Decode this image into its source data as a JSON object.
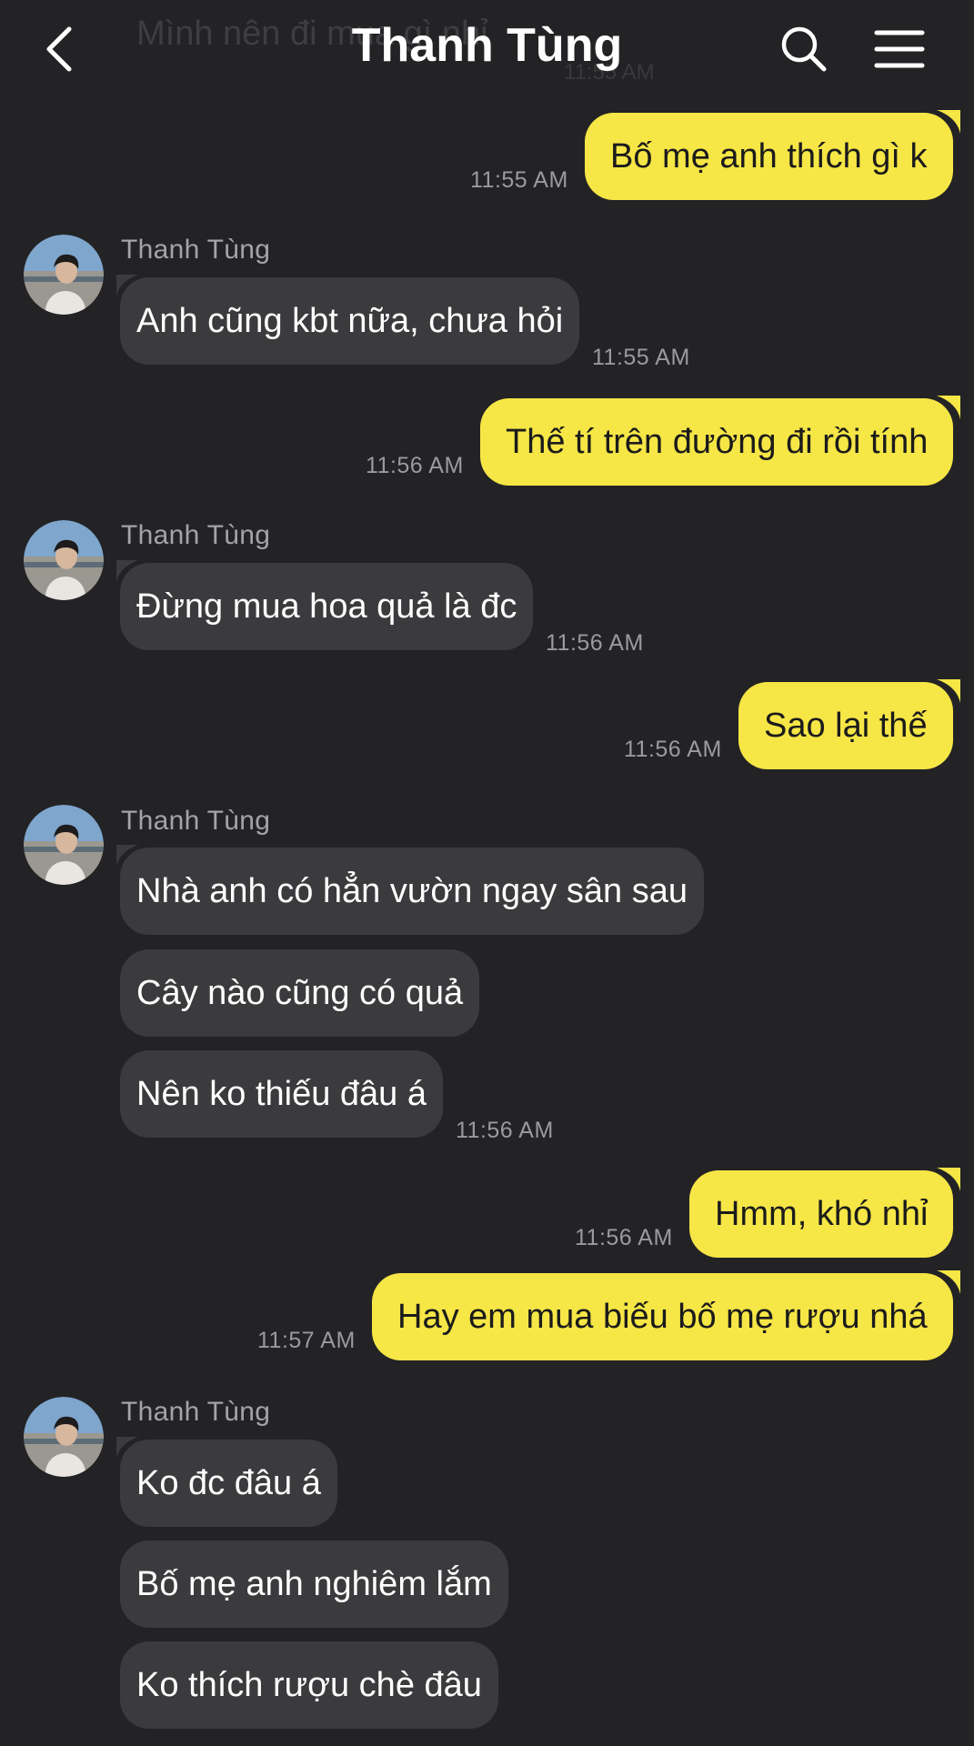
{
  "header": {
    "title": "Thanh Tùng",
    "ghost_preview": "Mình nên đi mua gì nhỉ",
    "ghost_time": "11:55 AM"
  },
  "icons": {
    "back": "chevron-left-icon",
    "search": "search-icon",
    "menu": "hamburger-menu-icon"
  },
  "colors": {
    "background": "#232325",
    "outgoing_bubble": "#f6e646",
    "incoming_bubble": "#3b3b3e",
    "timestamp": "#9a9a9f"
  },
  "messages": [
    {
      "dir": "out",
      "text": "Bố mẹ anh thích gì k",
      "time": "11:55 AM"
    },
    {
      "dir": "in",
      "sender": "Thanh Tùng",
      "text": "Anh cũng kbt nữa, chưa hỏi",
      "time": "11:55 AM"
    },
    {
      "dir": "out",
      "text": "Thế tí trên đường đi rồi tính",
      "time": "11:56 AM"
    },
    {
      "dir": "in",
      "sender": "Thanh Tùng",
      "text": "Đừng mua hoa quả là đc",
      "time": "11:56 AM"
    },
    {
      "dir": "out",
      "text": "Sao lại thế",
      "time": "11:56 AM"
    },
    {
      "dir": "in",
      "sender": "Thanh Tùng",
      "text": "Nhà anh có hẳn vườn ngay sân sau"
    },
    {
      "dir": "in",
      "text": "Cây nào cũng có quả"
    },
    {
      "dir": "in",
      "text": "Nên ko thiếu đâu á",
      "time": "11:56 AM"
    },
    {
      "dir": "out",
      "text": "Hmm, khó nhỉ",
      "time": "11:56 AM"
    },
    {
      "dir": "out",
      "text": "Hay em mua biếu bố mẹ rượu nhá",
      "time": "11:57 AM"
    },
    {
      "dir": "in",
      "sender": "Thanh Tùng",
      "text": "Ko đc đâu á"
    },
    {
      "dir": "in",
      "text": "Bố mẹ anh nghiêm lắm"
    },
    {
      "dir": "in",
      "text": "Ko thích rượu chè đâu"
    }
  ]
}
